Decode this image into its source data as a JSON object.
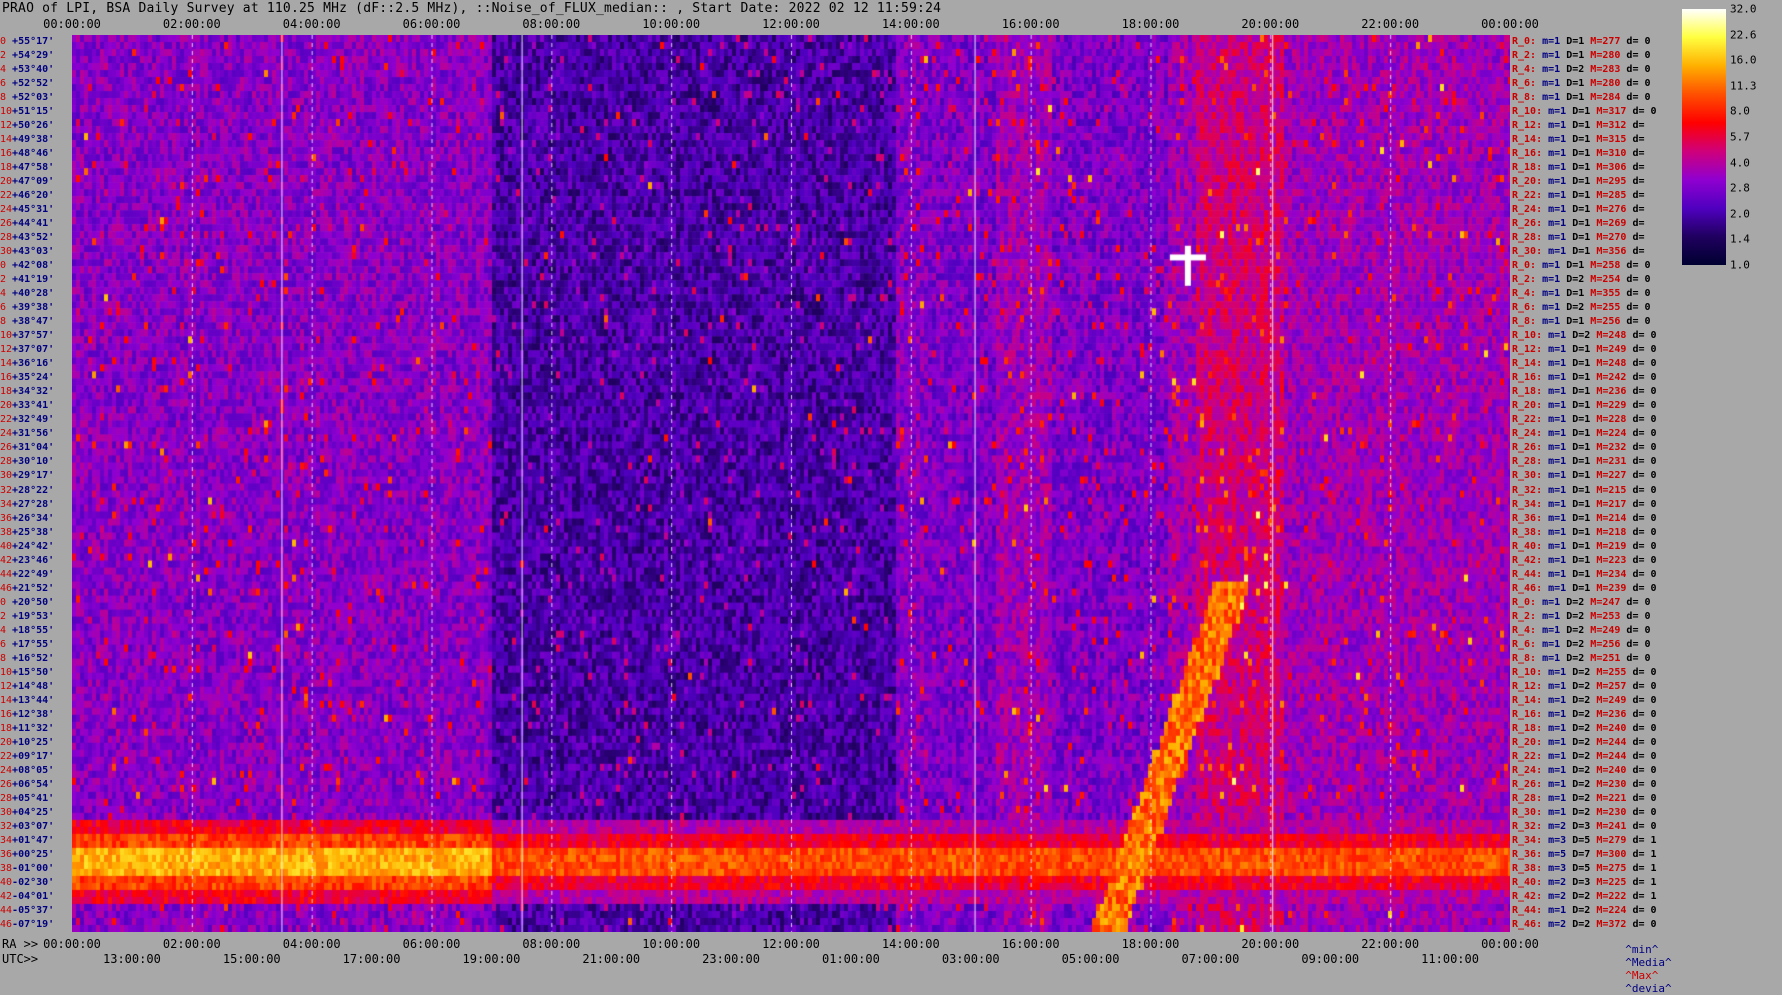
{
  "title": "PRAO of LPI, BSA Daily Survey at 110.25 MHz (dF::2.5 MHz), ::Noise_of_FLUX_median:: , Start Date: 2022 02 12 11:59:24",
  "chart_data": {
    "type": "heatmap",
    "top_time_ticks": [
      "00:00:00",
      "02:00:00",
      "04:00:00",
      "06:00:00",
      "08:00:00",
      "10:00:00",
      "12:00:00",
      "14:00:00",
      "16:00:00",
      "18:00:00",
      "20:00:00",
      "22:00:00",
      "00:00:00"
    ],
    "ra_label": "RA >>",
    "ra_ticks": [
      "00:00:00",
      "02:00:00",
      "04:00:00",
      "06:00:00",
      "08:00:00",
      "10:00:00",
      "12:00:00",
      "14:00:00",
      "16:00:00",
      "18:00:00",
      "20:00:00",
      "22:00:00",
      "00:00:00"
    ],
    "utc_label": "UTC>>",
    "utc_ticks": [
      "13:00:00",
      "15:00:00",
      "17:00:00",
      "19:00:00",
      "21:00:00",
      "23:00:00",
      "01:00:00",
      "03:00:00",
      "05:00:00",
      "07:00:00",
      "09:00:00",
      "11:00:00"
    ],
    "colorbar_ticks": [
      "32.0",
      "22.6",
      "16.0",
      "11.3",
      "8.0",
      "5.7",
      "4.0",
      "2.8",
      "2.0",
      "1.4",
      "1.0"
    ],
    "colorbar_colors": [
      "#ffffff",
      "#ffff40",
      "#ffb000",
      "#ff5000",
      "#ff0000",
      "#d0007a",
      "#9000d0",
      "#5000c0",
      "#200060",
      "#000030"
    ],
    "footer": {
      "min": "^min^",
      "median": "^Media^",
      "max": "^Max^",
      "dev": "^devia^"
    },
    "rows": [
      {
        "i": "0",
        "dec": "+55°17'",
        "r": "R_0:",
        "m": "1",
        "D": "1",
        "M": "277",
        "d": "0"
      },
      {
        "i": "2",
        "dec": "+54°29'",
        "r": "R_2:",
        "m": "1",
        "D": "1",
        "M": "280",
        "d": "0"
      },
      {
        "i": "4",
        "dec": "+53°40'",
        "r": "R_4:",
        "m": "1",
        "D": "2",
        "M": "283",
        "d": "0"
      },
      {
        "i": "6",
        "dec": "+52°52'",
        "r": "R_6:",
        "m": "1",
        "D": "1",
        "M": "280",
        "d": "0"
      },
      {
        "i": "8",
        "dec": "+52°03'",
        "r": "R_8:",
        "m": "1",
        "D": "1",
        "M": "284",
        "d": "0"
      },
      {
        "i": "10",
        "dec": "+51°15'",
        "r": "R_10:",
        "m": "1",
        "D": "1",
        "M": "317",
        "d": "0"
      },
      {
        "i": "12",
        "dec": "+50°26'",
        "r": "R_12:",
        "m": "1",
        "D": "1",
        "M": "312",
        "d": ""
      },
      {
        "i": "14",
        "dec": "+49°38'",
        "r": "R_14:",
        "m": "1",
        "D": "1",
        "M": "315",
        "d": ""
      },
      {
        "i": "16",
        "dec": "+48°46'",
        "r": "R_16:",
        "m": "1",
        "D": "1",
        "M": "310",
        "d": ""
      },
      {
        "i": "18",
        "dec": "+47°58'",
        "r": "R_18:",
        "m": "1",
        "D": "1",
        "M": "306",
        "d": ""
      },
      {
        "i": "20",
        "dec": "+47°09'",
        "r": "R_20:",
        "m": "1",
        "D": "1",
        "M": "295",
        "d": ""
      },
      {
        "i": "22",
        "dec": "+46°20'",
        "r": "R_22:",
        "m": "1",
        "D": "1",
        "M": "285",
        "d": ""
      },
      {
        "i": "24",
        "dec": "+45°31'",
        "r": "R_24:",
        "m": "1",
        "D": "1",
        "M": "276",
        "d": ""
      },
      {
        "i": "26",
        "dec": "+44°41'",
        "r": "R_26:",
        "m": "1",
        "D": "1",
        "M": "269",
        "d": ""
      },
      {
        "i": "28",
        "dec": "+43°52'",
        "r": "R_28:",
        "m": "1",
        "D": "1",
        "M": "270",
        "d": ""
      },
      {
        "i": "30",
        "dec": "+43°03'",
        "r": "R_30:",
        "m": "1",
        "D": "1",
        "M": "356",
        "d": ""
      },
      {
        "i": "0",
        "dec": "+42°08'",
        "r": "R_0:",
        "m": "1",
        "D": "1",
        "M": "258",
        "d": "0"
      },
      {
        "i": "2",
        "dec": "+41°19'",
        "r": "R_2:",
        "m": "1",
        "D": "2",
        "M": "254",
        "d": "0"
      },
      {
        "i": "4",
        "dec": "+40°28'",
        "r": "R_4:",
        "m": "1",
        "D": "1",
        "M": "355",
        "d": "0"
      },
      {
        "i": "6",
        "dec": "+39°38'",
        "r": "R_6:",
        "m": "1",
        "D": "2",
        "M": "255",
        "d": "0"
      },
      {
        "i": "8",
        "dec": "+38°47'",
        "r": "R_8:",
        "m": "1",
        "D": "1",
        "M": "256",
        "d": "0"
      },
      {
        "i": "10",
        "dec": "+37°57'",
        "r": "R_10:",
        "m": "1",
        "D": "2",
        "M": "248",
        "d": "0"
      },
      {
        "i": "12",
        "dec": "+37°07'",
        "r": "R_12:",
        "m": "1",
        "D": "1",
        "M": "249",
        "d": "0"
      },
      {
        "i": "14",
        "dec": "+36°16'",
        "r": "R_14:",
        "m": "1",
        "D": "1",
        "M": "248",
        "d": "0"
      },
      {
        "i": "16",
        "dec": "+35°24'",
        "r": "R_16:",
        "m": "1",
        "D": "1",
        "M": "242",
        "d": "0"
      },
      {
        "i": "18",
        "dec": "+34°32'",
        "r": "R_18:",
        "m": "1",
        "D": "1",
        "M": "236",
        "d": "0"
      },
      {
        "i": "20",
        "dec": "+33°41'",
        "r": "R_20:",
        "m": "1",
        "D": "1",
        "M": "229",
        "d": "0"
      },
      {
        "i": "22",
        "dec": "+32°49'",
        "r": "R_22:",
        "m": "1",
        "D": "1",
        "M": "228",
        "d": "0"
      },
      {
        "i": "24",
        "dec": "+31°56'",
        "r": "R_24:",
        "m": "1",
        "D": "1",
        "M": "224",
        "d": "0"
      },
      {
        "i": "26",
        "dec": "+31°04'",
        "r": "R_26:",
        "m": "1",
        "D": "1",
        "M": "232",
        "d": "0"
      },
      {
        "i": "28",
        "dec": "+30°10'",
        "r": "R_28:",
        "m": "1",
        "D": "1",
        "M": "231",
        "d": "0"
      },
      {
        "i": "30",
        "dec": "+29°17'",
        "r": "R_30:",
        "m": "1",
        "D": "1",
        "M": "227",
        "d": "0"
      },
      {
        "i": "32",
        "dec": "+28°22'",
        "r": "R_32:",
        "m": "1",
        "D": "1",
        "M": "215",
        "d": "0"
      },
      {
        "i": "34",
        "dec": "+27°28'",
        "r": "R_34:",
        "m": "1",
        "D": "1",
        "M": "217",
        "d": "0"
      },
      {
        "i": "36",
        "dec": "+26°34'",
        "r": "R_36:",
        "m": "1",
        "D": "1",
        "M": "214",
        "d": "0"
      },
      {
        "i": "38",
        "dec": "+25°38'",
        "r": "R_38:",
        "m": "1",
        "D": "1",
        "M": "218",
        "d": "0"
      },
      {
        "i": "40",
        "dec": "+24°42'",
        "r": "R_40:",
        "m": "1",
        "D": "1",
        "M": "219",
        "d": "0"
      },
      {
        "i": "42",
        "dec": "+23°46'",
        "r": "R_42:",
        "m": "1",
        "D": "1",
        "M": "223",
        "d": "0"
      },
      {
        "i": "44",
        "dec": "+22°49'",
        "r": "R_44:",
        "m": "1",
        "D": "1",
        "M": "234",
        "d": "0"
      },
      {
        "i": "46",
        "dec": "+21°52'",
        "r": "R_46:",
        "m": "1",
        "D": "1",
        "M": "239",
        "d": "0"
      },
      {
        "i": "0",
        "dec": "+20°50'",
        "r": "R_0:",
        "m": "1",
        "D": "2",
        "M": "247",
        "d": "0"
      },
      {
        "i": "2",
        "dec": "+19°53'",
        "r": "R_2:",
        "m": "1",
        "D": "2",
        "M": "253",
        "d": "0"
      },
      {
        "i": "4",
        "dec": "+18°55'",
        "r": "R_4:",
        "m": "1",
        "D": "2",
        "M": "249",
        "d": "0"
      },
      {
        "i": "6",
        "dec": "+17°55'",
        "r": "R_6:",
        "m": "1",
        "D": "2",
        "M": "256",
        "d": "0"
      },
      {
        "i": "8",
        "dec": "+16°52'",
        "r": "R_8:",
        "m": "1",
        "D": "2",
        "M": "251",
        "d": "0"
      },
      {
        "i": "10",
        "dec": "+15°50'",
        "r": "R_10:",
        "m": "1",
        "D": "2",
        "M": "255",
        "d": "0"
      },
      {
        "i": "12",
        "dec": "+14°48'",
        "r": "R_12:",
        "m": "1",
        "D": "2",
        "M": "257",
        "d": "0"
      },
      {
        "i": "14",
        "dec": "+13°44'",
        "r": "R_14:",
        "m": "1",
        "D": "2",
        "M": "249",
        "d": "0"
      },
      {
        "i": "16",
        "dec": "+12°38'",
        "r": "R_16:",
        "m": "1",
        "D": "2",
        "M": "236",
        "d": "0"
      },
      {
        "i": "18",
        "dec": "+11°32'",
        "r": "R_18:",
        "m": "1",
        "D": "2",
        "M": "240",
        "d": "0"
      },
      {
        "i": "20",
        "dec": "+10°25'",
        "r": "R_20:",
        "m": "1",
        "D": "2",
        "M": "244",
        "d": "0"
      },
      {
        "i": "22",
        "dec": "+09°17'",
        "r": "R_22:",
        "m": "1",
        "D": "2",
        "M": "244",
        "d": "0"
      },
      {
        "i": "24",
        "dec": "+08°05'",
        "r": "R_24:",
        "m": "1",
        "D": "2",
        "M": "240",
        "d": "0"
      },
      {
        "i": "26",
        "dec": "+06°54'",
        "r": "R_26:",
        "m": "1",
        "D": "2",
        "M": "230",
        "d": "0"
      },
      {
        "i": "28",
        "dec": "+05°41'",
        "r": "R_28:",
        "m": "1",
        "D": "2",
        "M": "221",
        "d": "0"
      },
      {
        "i": "30",
        "dec": "+04°25'",
        "r": "R_30:",
        "m": "1",
        "D": "2",
        "M": "230",
        "d": "0"
      },
      {
        "i": "32",
        "dec": "+03°07'",
        "r": "R_32:",
        "m": "2",
        "D": "3",
        "M": "241",
        "d": "0"
      },
      {
        "i": "34",
        "dec": "+01°47'",
        "r": "R_34:",
        "m": "3",
        "D": "5",
        "M": "279",
        "d": "1"
      },
      {
        "i": "36",
        "dec": "+00°25'",
        "r": "R_36:",
        "m": "5",
        "D": "7",
        "M": "300",
        "d": "1"
      },
      {
        "i": "38",
        "dec": "-01°00'",
        "r": "R_38:",
        "m": "3",
        "D": "5",
        "M": "275",
        "d": "1"
      },
      {
        "i": "40",
        "dec": "-02°30'",
        "r": "R_40:",
        "m": "2",
        "D": "3",
        "M": "225",
        "d": "1"
      },
      {
        "i": "42",
        "dec": "-04°01'",
        "r": "R_42:",
        "m": "2",
        "D": "2",
        "M": "222",
        "d": "1"
      },
      {
        "i": "44",
        "dec": "-05°37'",
        "r": "R_44:",
        "m": "1",
        "D": "2",
        "M": "224",
        "d": "0"
      },
      {
        "i": "46",
        "dec": "-07°19'",
        "r": "R_46:",
        "m": "2",
        "D": "2",
        "M": "372",
        "d": "0"
      }
    ]
  }
}
